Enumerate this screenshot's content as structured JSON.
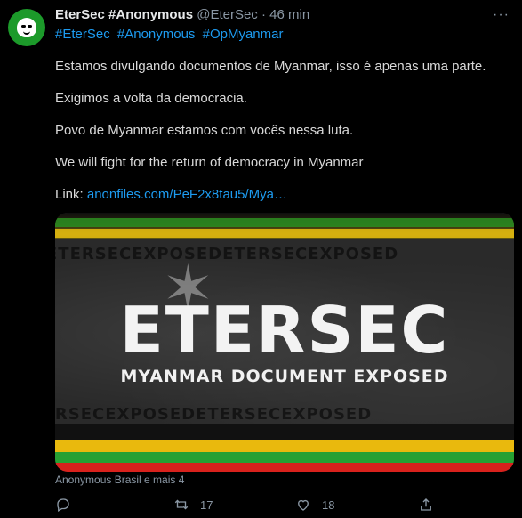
{
  "tweet": {
    "author_name": "EterSec #Anonymous",
    "handle": "@EterSec",
    "separator": "·",
    "time": "46 min",
    "more_label": "···",
    "hashtags": [
      "#EterSec",
      "#Anonymous",
      "#OpMyanmar"
    ],
    "paragraphs": [
      "Estamos divulgando documentos de Myanmar, isso é apenas uma parte.",
      "Exigimos a volta da democracia.",
      "Povo de Myanmar estamos com vocês nessa luta.",
      "We will fight for the return of democracy in Myanmar"
    ],
    "link_label": "Link:",
    "link_text": "anonfiles.com/PeF2x8tau5/Mya…",
    "media": {
      "title": "ETERSEC",
      "subtitle": "MYANMAR DOCUMENT EXPOSED",
      "watermark": "ETERSECEXPOSEDETERSECEXPOSED"
    },
    "media_caption": "Anonymous Brasil e mais 4",
    "actions": {
      "reply_count": "",
      "retweet_count": "17",
      "like_count": "18"
    }
  },
  "icons": {
    "avatar": "anonymous-mask-icon",
    "reply": "reply-icon",
    "retweet": "retweet-icon",
    "like": "heart-icon",
    "share": "share-icon"
  },
  "colors": {
    "background": "#000000",
    "link": "#1d9bf0",
    "muted": "#8b98a5",
    "avatar_bg": "#1c9a2a"
  }
}
